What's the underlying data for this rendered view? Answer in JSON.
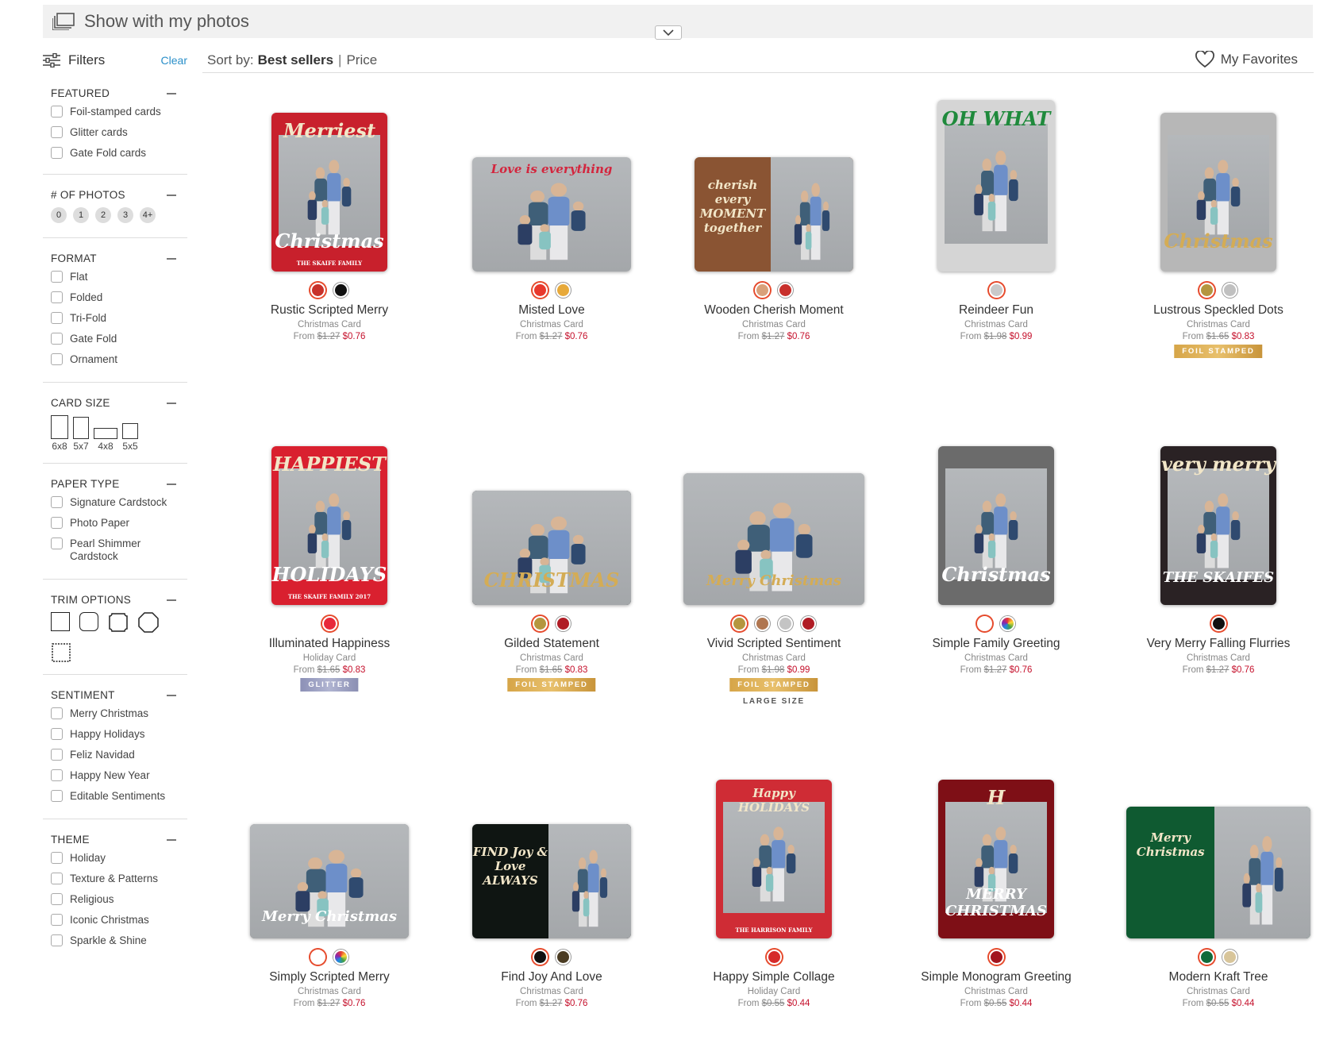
{
  "topbar": {
    "label": "Show with my photos"
  },
  "filters": {
    "label": "Filters",
    "clear": "Clear"
  },
  "sort": {
    "label": "Sort by:",
    "best": "Best sellers",
    "sep": "|",
    "price": "Price"
  },
  "favorites": {
    "label": "My Favorites"
  },
  "sections": {
    "featured": {
      "title": "FEATURED",
      "options": [
        "Foil-stamped cards",
        "Glitter cards",
        "Gate Fold cards"
      ]
    },
    "photos": {
      "title": "# OF PHOTOS",
      "pills": [
        "0",
        "1",
        "2",
        "3",
        "4+"
      ]
    },
    "format": {
      "title": "FORMAT",
      "options": [
        "Flat",
        "Folded",
        "Tri-Fold",
        "Gate Fold",
        "Ornament"
      ]
    },
    "cardsize": {
      "title": "CARD SIZE",
      "sizes": [
        "6x8",
        "5x7",
        "4x8",
        "5x5"
      ]
    },
    "paper": {
      "title": "PAPER TYPE",
      "options": [
        "Signature Cardstock",
        "Photo Paper",
        "Pearl Shimmer Cardstock"
      ]
    },
    "trim": {
      "title": "TRIM OPTIONS"
    },
    "sentiment": {
      "title": "SENTIMENT",
      "options": [
        "Merry Christmas",
        "Happy Holidays",
        "Feliz Navidad",
        "Happy New Year",
        "Editable Sentiments"
      ]
    },
    "theme": {
      "title": "THEME",
      "options": [
        "Holiday",
        "Texture & Patterns",
        "Religious",
        "Iconic Christmas",
        "Sparkle & Shine"
      ]
    }
  },
  "products": [
    {
      "name": "Rustic Scripted Merry",
      "type": "Christmas Card",
      "from": "From",
      "old": "$1.27",
      "new": "$0.76",
      "swatches": [
        "#c8322a",
        "#111111"
      ],
      "headline": "Merriest",
      "headline2": "Christmas",
      "footer_text": "THE SKAIFE FAMILY",
      "badge": "",
      "bg": "#c8202c"
    },
    {
      "name": "Misted Love",
      "type": "Christmas Card",
      "from": "From",
      "old": "$1.27",
      "new": "$0.76",
      "swatches": [
        "#e8392d",
        "#e7a93a"
      ],
      "headline": "Love is everything",
      "headline2": "",
      "footer_text": "",
      "badge": "",
      "bg": "#ffffff"
    },
    {
      "name": "Wooden Cherish Moment",
      "type": "Christmas Card",
      "from": "From",
      "old": "$1.27",
      "new": "$0.76",
      "swatches": [
        "#d9a07a",
        "#c8302c"
      ],
      "headline": "cherish every MOMENT together",
      "headline2": "",
      "footer_text": "",
      "badge": "",
      "bg": "#8a5433"
    },
    {
      "name": "Reindeer Fun",
      "type": "Christmas Card",
      "from": "From",
      "old": "$1.98",
      "new": "$0.99",
      "swatches": [
        "#c9c9c9"
      ],
      "headline": "OH WHAT",
      "headline2": "",
      "footer_text": "",
      "badge": "",
      "bg": "#d5d5d5"
    },
    {
      "name": "Lustrous Speckled Dots",
      "type": "Christmas Card",
      "from": "From",
      "old": "$1.65",
      "new": "$0.83",
      "swatches": [
        "#b5963f",
        "#c0c0c0"
      ],
      "headline": "",
      "headline2": "Christmas",
      "footer_text": "",
      "badge": "FOIL STAMPED",
      "bg": "#b7b7b7"
    },
    {
      "name": "Illuminated Happiness",
      "type": "Holiday Card",
      "from": "From",
      "old": "$1.65",
      "new": "$0.83",
      "swatches": [
        "#e8283a"
      ],
      "headline": "HAPPIEST",
      "headline2": "HOLIDAYS",
      "footer_text": "THE SKAIFE FAMILY 2017",
      "badge": "GLITTER",
      "bg": "#d9202f"
    },
    {
      "name": "Gilded Statement",
      "type": "Christmas Card",
      "from": "From",
      "old": "$1.65",
      "new": "$0.83",
      "swatches": [
        "#b5963f",
        "#b01c25"
      ],
      "headline": "",
      "headline2": "CHRISTMAS",
      "footer_text": "",
      "badge": "FOIL STAMPED",
      "bg": "#222222"
    },
    {
      "name": "Vivid Scripted Sentiment",
      "type": "Christmas Card",
      "from": "From",
      "old": "$1.98",
      "new": "$0.99",
      "swatches": [
        "#b5963f",
        "#b07650",
        "#c4c4c4",
        "#b01c25"
      ],
      "headline": "",
      "headline2": "Merry Christmas",
      "footer_text": "",
      "badge": "FOIL STAMPED",
      "extra": "LARGE SIZE",
      "bg": "#a9a9a9"
    },
    {
      "name": "Simple Family Greeting",
      "type": "Christmas Card",
      "from": "From",
      "old": "$1.27",
      "new": "$0.76",
      "swatches": [
        "#ffffff",
        "multi"
      ],
      "headline": "",
      "headline2": "Christmas",
      "footer_text": "",
      "badge": "",
      "bg": "#6b6b6b"
    },
    {
      "name": "Very Merry Falling Flurries",
      "type": "Christmas Card",
      "from": "From",
      "old": "$1.27",
      "new": "$0.76",
      "swatches": [
        "#111111"
      ],
      "headline": "very merry",
      "headline2": "THE SKAIFES",
      "footer_text": "",
      "badge": "",
      "bg": "#2a2224"
    },
    {
      "name": "Simply Scripted Merry",
      "type": "Christmas Card",
      "from": "From",
      "old": "$1.27",
      "new": "$0.76",
      "swatches": [
        "#ffffff",
        "multi"
      ],
      "headline": "",
      "headline2": "Merry Christmas",
      "footer_text": "",
      "badge": "",
      "bg": "#777777"
    },
    {
      "name": "Find Joy And Love",
      "type": "Christmas Card",
      "from": "From",
      "old": "$1.27",
      "new": "$0.76",
      "swatches": [
        "#111111",
        "#4a3b22"
      ],
      "headline": "FIND Joy & Love ALWAYS",
      "headline2": "",
      "footer_text": "",
      "badge": "",
      "bg": "#0f1512"
    },
    {
      "name": "Happy Simple Collage",
      "type": "Holiday Card",
      "from": "From",
      "old": "$0.55",
      "new": "$0.44",
      "swatches": [
        "#d62a2a"
      ],
      "headline": "Happy HOLIDAYS",
      "headline2": "",
      "footer_text": "THE HARRISON FAMILY",
      "badge": "",
      "bg": "#cf2c35"
    },
    {
      "name": "Simple Monogram Greeting",
      "type": "Christmas Card",
      "from": "From",
      "old": "$0.55",
      "new": "$0.44",
      "swatches": [
        "#a3151e"
      ],
      "headline": "H",
      "headline2": "MERRY CHRISTMAS",
      "footer_text": "",
      "badge": "",
      "bg": "#7e0f16"
    },
    {
      "name": "Modern Kraft Tree",
      "type": "Christmas Card",
      "from": "From",
      "old": "$0.55",
      "new": "$0.44",
      "swatches": [
        "#106a3a",
        "#d8c59a"
      ],
      "headline": "Merry Christmas",
      "headline2": "",
      "footer_text": "",
      "badge": "",
      "bg": "#0f5a31"
    }
  ]
}
